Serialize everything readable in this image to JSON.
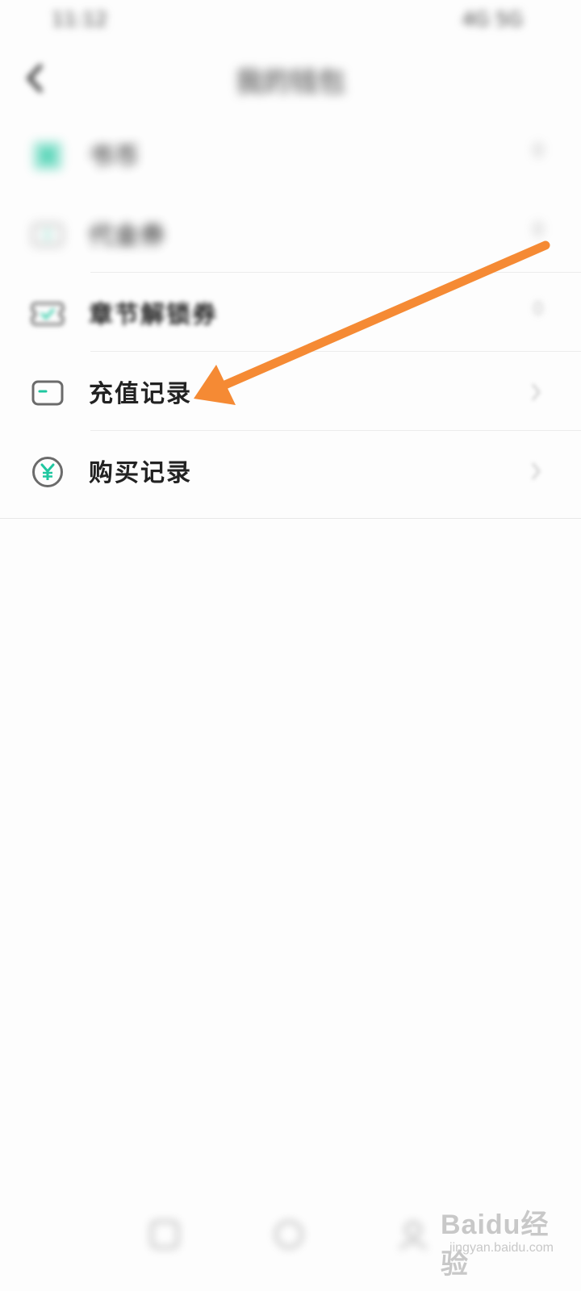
{
  "status_bar": {
    "time": "11:12",
    "indicators": "4G 5G"
  },
  "navbar": {
    "title": "我的钱包",
    "back_icon": "chevron-left-icon"
  },
  "list": [
    {
      "label": "书币",
      "value": "0",
      "icon": "coin-icon"
    },
    {
      "label": "代金券",
      "value": "0",
      "icon": "voucher-icon"
    },
    {
      "label": "章节解锁券",
      "value": "0",
      "icon": "unlock-ticket-icon"
    },
    {
      "label": "充值记录",
      "value": "",
      "icon": "recharge-card-icon"
    },
    {
      "label": "购买记录",
      "value": "",
      "icon": "yen-circle-icon"
    }
  ],
  "colors": {
    "accent": "#1fc7a0",
    "arrow": "#f58a34",
    "icon_stroke": "#6b6b6b"
  },
  "watermark": {
    "logo": "Baidu经验",
    "url": "jingyan.baidu.com"
  }
}
